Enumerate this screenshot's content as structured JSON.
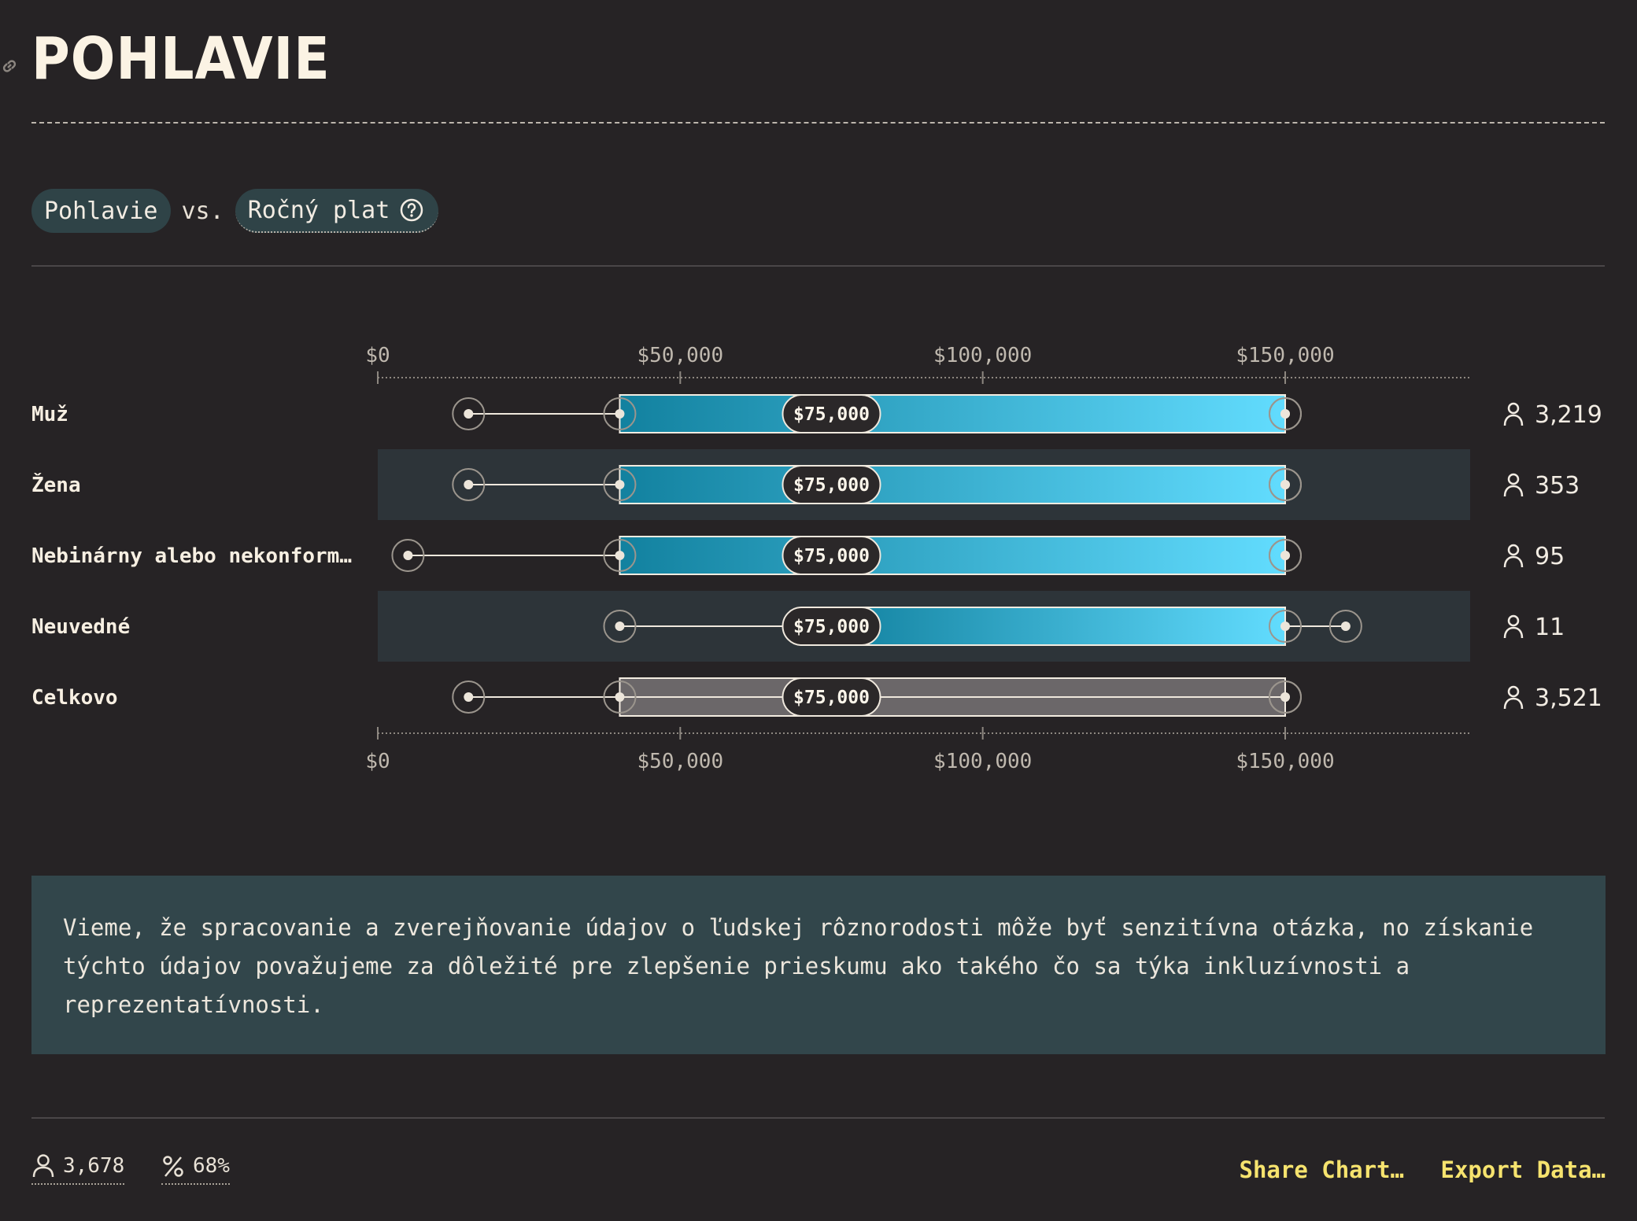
{
  "page": {
    "title": "POHLAVIE",
    "icon": "link-icon"
  },
  "filters": {
    "primary": "Pohlavie",
    "separator": "vs.",
    "secondary": "Ročný plat",
    "secondary_icon": "help-circle-icon"
  },
  "chart_data": {
    "type": "box-range",
    "x_unit": "USD",
    "xlim": [
      0,
      190000
    ],
    "x_ticks": [
      0,
      50000,
      100000,
      150000
    ],
    "x_tick_labels": [
      "$0",
      "$50,000",
      "$100,000",
      "$150,000"
    ],
    "axis_position": "top and bottom",
    "rows": [
      {
        "label": "Muž",
        "p10": 15000,
        "p25": 40000,
        "median": 75000,
        "p75": 150000,
        "p90": 150000,
        "count": "3,219",
        "style": "gradient",
        "band": false
      },
      {
        "label": "Žena",
        "p10": 15000,
        "p25": 40000,
        "median": 75000,
        "p75": 150000,
        "p90": 150000,
        "count": "353",
        "style": "gradient",
        "band": true
      },
      {
        "label": "Nebinárny alebo nekonform…",
        "p10": 5000,
        "p25": 40000,
        "median": 75000,
        "p75": 150000,
        "p90": 150000,
        "count": "95",
        "style": "gradient",
        "band": false
      },
      {
        "label": "Neuvedné",
        "p10": 40000,
        "p25": 75000,
        "median": 75000,
        "p75": 150000,
        "p90": 160000,
        "count": "11",
        "style": "gradient",
        "band": true
      },
      {
        "label": "Celkovo",
        "p10": 15000,
        "p25": 40000,
        "median": 75000,
        "p75": 150000,
        "p90": 150000,
        "count": "3,521",
        "style": "gray",
        "band": false
      }
    ],
    "median_label": "$75,000",
    "colors": {
      "gradient_start": "#12819f",
      "gradient_end": "#62dcfe",
      "total_fill": "#6b6769",
      "band": "#2d3439"
    }
  },
  "note": {
    "text": "Vieme, že spracovanie a zverejňovanie údajov o ľudskej rôznorodosti môže byť senzitívna otázka, no získanie týchto údajov považujeme za dôležité pre zlepšenie prieskumu ako takého čo sa týka inkluzívnosti a reprezentatívnosti."
  },
  "footer": {
    "respondents": "3,678",
    "respondents_icon": "person-icon",
    "percent": "68%",
    "percent_icon": "percent-icon",
    "share_label": "Share Chart…",
    "export_label": "Export Data…"
  }
}
